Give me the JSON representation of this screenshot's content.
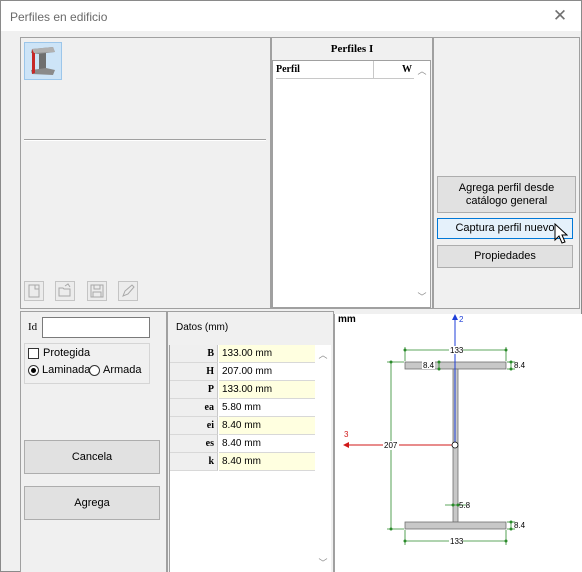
{
  "window": {
    "title": "Perfiles en edificio",
    "close_glyph": "✕"
  },
  "toolbar": {
    "icons": [
      "new-icon",
      "open-icon",
      "save-icon",
      "edit-icon"
    ]
  },
  "profiles_list": {
    "title": "Perfiles I",
    "columns": [
      "Perfil",
      "W"
    ],
    "rows": []
  },
  "actions": {
    "add_from_catalog": "Agrega perfil desde catálogo general",
    "capture_new": "Captura perfil nuevo",
    "properties": "Propiedades"
  },
  "form": {
    "id_label": "Id",
    "id_value": "",
    "protegida_label": "Protegida",
    "protegida_checked": false,
    "laminada_label": "Laminada",
    "armada_label": "Armada",
    "selected_type": "Laminada",
    "cancel_label": "Cancela",
    "add_label": "Agrega"
  },
  "datos": {
    "title": "Datos (mm)",
    "rows": [
      {
        "key": "B",
        "value": "133.00 mm",
        "editable": true
      },
      {
        "key": "H",
        "value": "207.00 mm",
        "editable": false
      },
      {
        "key": "P",
        "value": "133.00 mm",
        "editable": true
      },
      {
        "key": "ea",
        "value": "5.80 mm",
        "editable": false
      },
      {
        "key": "ei",
        "value": "8.40 mm",
        "editable": true
      },
      {
        "key": "es",
        "value": "8.40 mm",
        "editable": false
      },
      {
        "key": "k",
        "value": "8.40 mm",
        "editable": true
      }
    ]
  },
  "drawing": {
    "units": "mm",
    "dims": {
      "top_width": "133",
      "top_flange": "8.4",
      "top_flange_left": "8.4",
      "height": "207",
      "web": "5.8",
      "bottom_flange": "8.4",
      "bottom_width": "133"
    },
    "axis_y_label": "2",
    "axis_x_label": "3",
    "colors": {
      "axis_y": "#1f3fd8",
      "axis_x": "#d01818",
      "dim": "#2a8a2a",
      "section": "#c8c8c8"
    }
  }
}
